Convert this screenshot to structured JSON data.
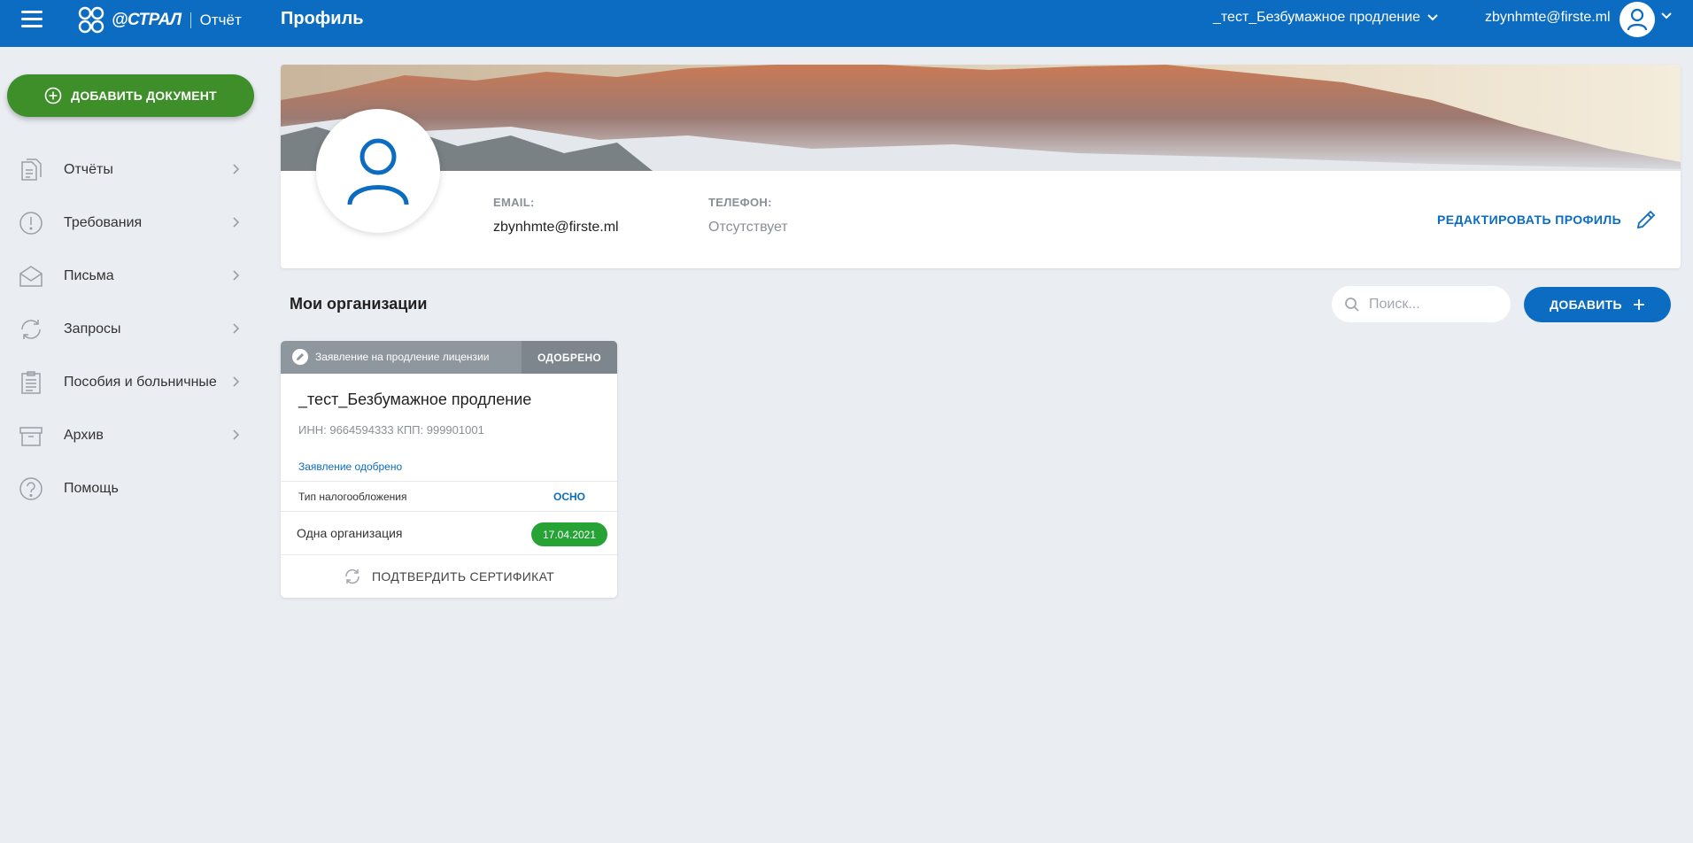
{
  "app": {
    "logo_word": "@СТРАЛ",
    "logo_sub": "Отчёт",
    "page_title": "Профиль"
  },
  "topbar": {
    "org_name": "_тест_Безбумажное продление",
    "user_email": "zbynhmte@firste.ml"
  },
  "sidebar": {
    "add_document_label": "ДОБАВИТЬ ДОКУМЕНТ",
    "items": [
      {
        "label": "Отчёты",
        "icon": "reports-icon",
        "has_submenu": true
      },
      {
        "label": "Требования",
        "icon": "exclamation-icon",
        "has_submenu": true
      },
      {
        "label": "Письма",
        "icon": "envelope-icon",
        "has_submenu": true
      },
      {
        "label": "Запросы",
        "icon": "refresh-icon",
        "has_submenu": true
      },
      {
        "label": "Пособия и больничные",
        "icon": "clipboard-icon",
        "has_submenu": true
      },
      {
        "label": "Архив",
        "icon": "archive-icon",
        "has_submenu": true
      },
      {
        "label": "Помощь",
        "icon": "help-icon",
        "has_submenu": false
      }
    ]
  },
  "profile": {
    "email_label": "EMAIL:",
    "email_value": "zbynhmte@firste.ml",
    "phone_label": "ТЕЛЕФОН:",
    "phone_value": "Отсутствует",
    "edit_label": "РЕДАКТИРОВАТЬ ПРОФИЛЬ"
  },
  "orgs": {
    "title": "Мои организации",
    "search_placeholder": "Поиск...",
    "add_label": "ДОБАВИТЬ",
    "cards": [
      {
        "header_label": "Заявление на продление лицензии",
        "status": "ОДОБРЕНО",
        "name": "_тест_Безбумажное продление",
        "ids": "ИНН: 9664594333  КПП: 999901001",
        "link_text": "Заявление одобрено",
        "tax_label": "Тип налогообложения",
        "tax_value": "ОСНО",
        "plan_label": "Одна организация",
        "plan_date": "17.04.2021",
        "cert_action": "ПОДТВЕРДИТЬ СЕРТИФИКАТ"
      }
    ]
  },
  "colors": {
    "brand_blue": "#0b6cc1",
    "add_green": "#3e8e2a",
    "badge_green": "#27a336",
    "background": "#eaedf2"
  }
}
